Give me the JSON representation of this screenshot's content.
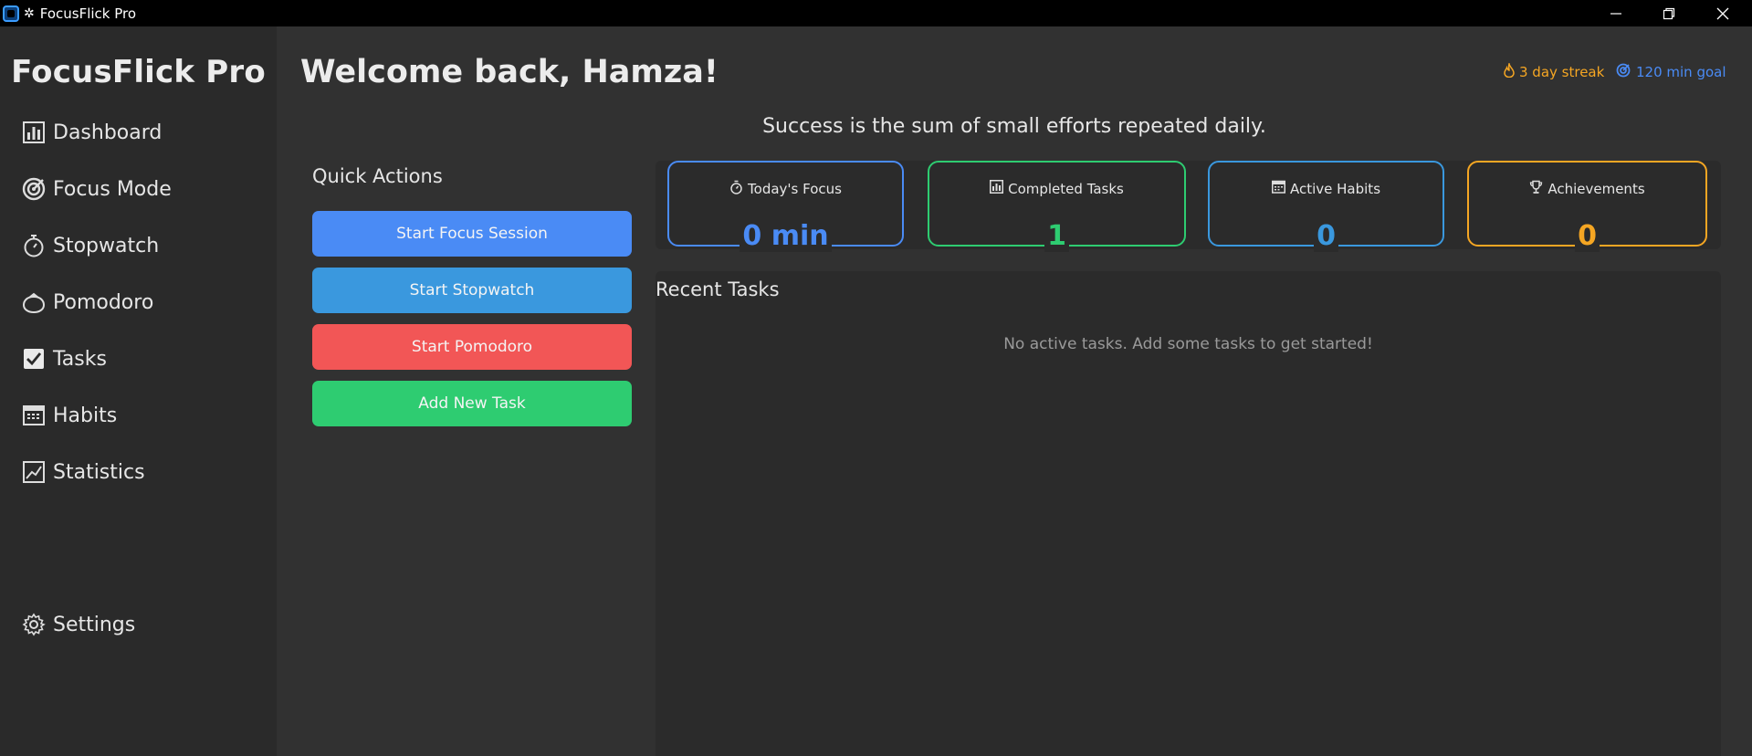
{
  "window": {
    "title": "FocusFlick Pro",
    "controls": [
      "minimize-icon",
      "restore-icon",
      "close-icon"
    ]
  },
  "sidebar": {
    "brand": "FocusFlick Pro",
    "items": [
      {
        "label": "Dashboard",
        "icon": "bar-chart-icon"
      },
      {
        "label": "Focus Mode",
        "icon": "target-icon"
      },
      {
        "label": "Stopwatch",
        "icon": "stopwatch-icon"
      },
      {
        "label": "Pomodoro",
        "icon": "tomato-icon"
      },
      {
        "label": "Tasks",
        "icon": "checkbox-icon"
      },
      {
        "label": "Habits",
        "icon": "calendar-icon"
      },
      {
        "label": "Statistics",
        "icon": "line-chart-icon"
      }
    ],
    "settings": {
      "label": "Settings",
      "icon": "gear-icon"
    }
  },
  "header": {
    "welcome": "Welcome back, Hamza!",
    "streak": "3 day streak",
    "goal": "120 min goal",
    "quote": "Success is the sum of small efforts repeated daily."
  },
  "quick_actions": {
    "title": "Quick Actions",
    "buttons": [
      {
        "label": "Start Focus Session",
        "color": "#4a8bf5"
      },
      {
        "label": "Start Stopwatch",
        "color": "#3a98de"
      },
      {
        "label": "Start Pomodoro",
        "color": "#f25656"
      },
      {
        "label": "Add New Task",
        "color": "#2ecc71"
      }
    ]
  },
  "stats": [
    {
      "label": "Today's Focus",
      "value": "0 min",
      "color": "#4a8bf5",
      "icon": "stopwatch-icon"
    },
    {
      "label": "Completed Tasks",
      "value": "1",
      "color": "#2ecc71",
      "icon": "bar-chart-icon"
    },
    {
      "label": "Active Habits",
      "value": "0",
      "color": "#3a98de",
      "icon": "calendar-icon"
    },
    {
      "label": "Achievements",
      "value": "0",
      "color": "#f5a623",
      "icon": "trophy-icon"
    }
  ],
  "recent_tasks": {
    "title": "Recent Tasks",
    "empty_message": "No active tasks. Add some tasks to get started!"
  },
  "colors": {
    "streak": "#f5a623",
    "goal": "#4a8bf5"
  }
}
